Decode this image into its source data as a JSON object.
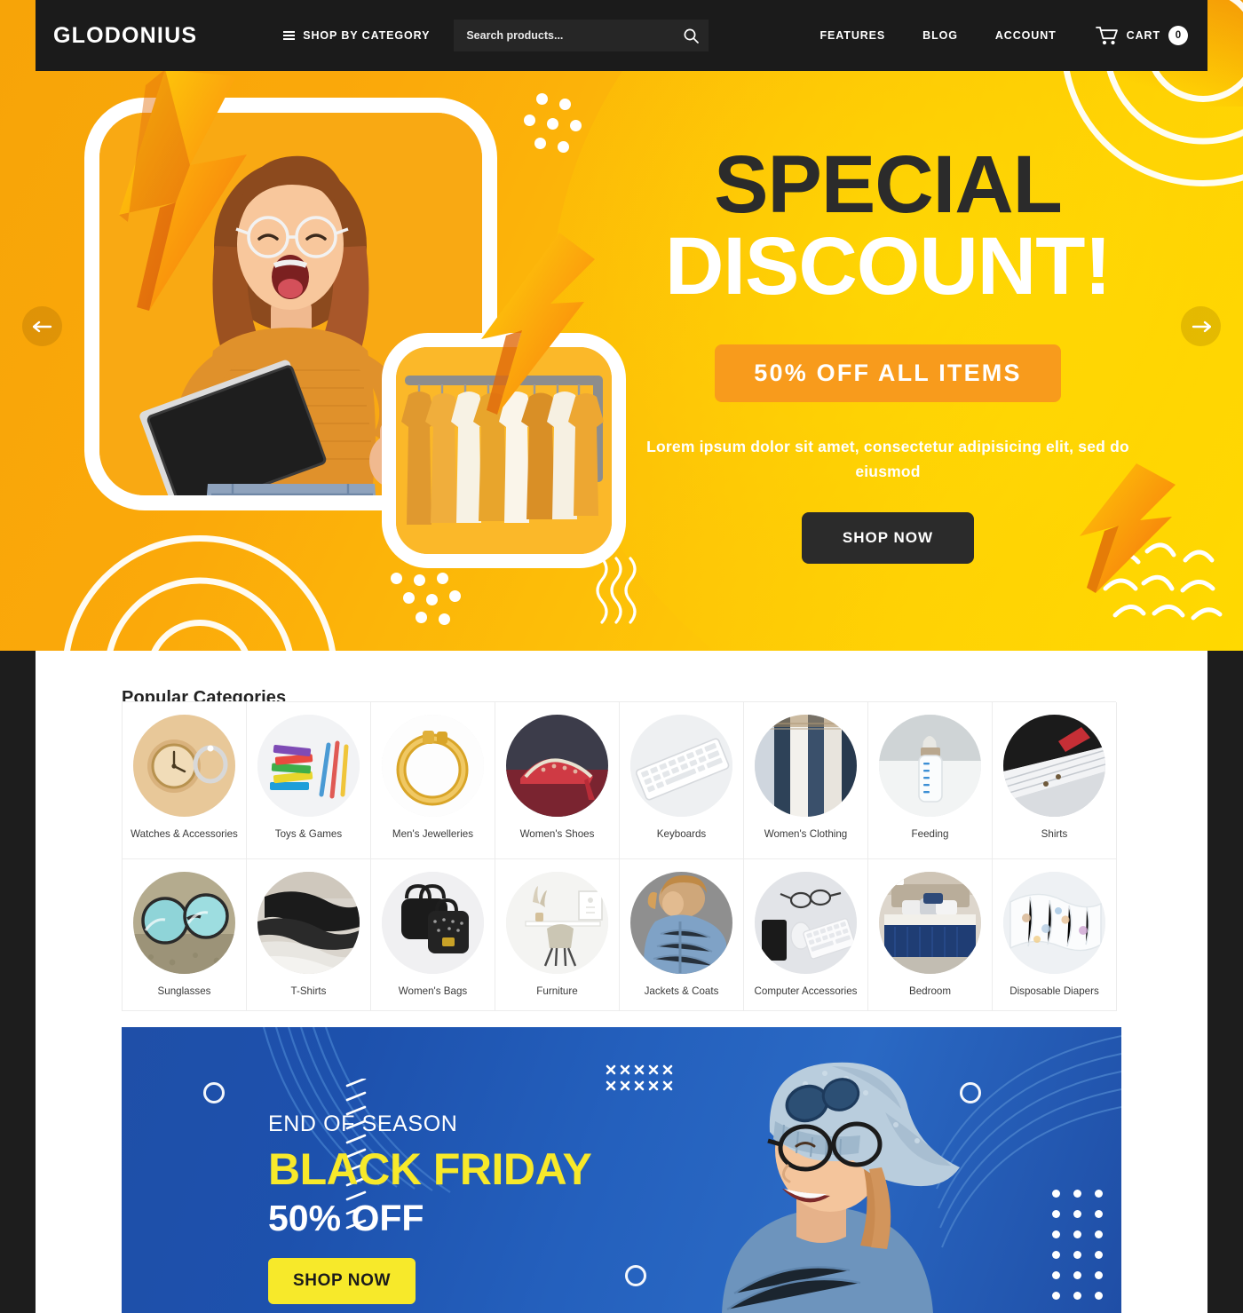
{
  "theme": {
    "header_bg": "#1b1b1b",
    "page_bg": "#1d1d1d",
    "hero_orange": "#f7a408",
    "hero_yellow": "#ffd900",
    "badge_orange": "#f89b1c",
    "dark": "#2b2b2b",
    "banner_blue": "#1f4fa8",
    "banner_yellow": "#f7e92a"
  },
  "header": {
    "logo": "GLODONIUS",
    "shop_by_category": "SHOP BY CATEGORY",
    "menu_icon": "hamburger-icon",
    "search": {
      "placeholder": "Search products...",
      "value": "",
      "icon": "search-icon"
    },
    "nav": [
      {
        "label": "FEATURES"
      },
      {
        "label": "BLOG"
      },
      {
        "label": "ACCOUNT"
      }
    ],
    "cart": {
      "label": "CART",
      "count": "0",
      "icon": "shopping-cart-icon"
    }
  },
  "hero": {
    "title_line1": "SPECIAL",
    "title_line2": "DISCOUNT!",
    "badge": "50% OFF ALL ITEMS",
    "subtitle": "Lorem ipsum dolor sit amet, consectetur adipisicing elit, sed do eiusmod",
    "cta": "SHOP NOW",
    "prev_icon": "arrow-left-icon",
    "next_icon": "arrow-right-icon",
    "image_alt_large": "woman-with-laptop-photo",
    "image_alt_small": "clothing-rack-photo"
  },
  "categories": {
    "title": "Popular Categories",
    "items": [
      {
        "label": "Watches & Accessories",
        "image": "watch-jewelry-thumb"
      },
      {
        "label": "Toys & Games",
        "image": "colorful-blocks-thumb"
      },
      {
        "label": "Men's Jewelleries",
        "image": "gold-bracelet-thumb"
      },
      {
        "label": "Women's Shoes",
        "image": "red-heels-thumb"
      },
      {
        "label": "Keyboards",
        "image": "white-keyboard-thumb"
      },
      {
        "label": "Women's Clothing",
        "image": "hanging-clothes-thumb"
      },
      {
        "label": "Feeding",
        "image": "baby-bottle-thumb"
      },
      {
        "label": "Shirts",
        "image": "dress-shirt-thumb"
      },
      {
        "label": "Sunglasses",
        "image": "round-sunglasses-thumb"
      },
      {
        "label": "T-Shirts",
        "image": "folded-tshirts-thumb"
      },
      {
        "label": "Women's Bags",
        "image": "black-handbags-thumb"
      },
      {
        "label": "Furniture",
        "image": "desk-chair-thumb"
      },
      {
        "label": "Jackets & Coats",
        "image": "denim-jacket-thumb"
      },
      {
        "label": "Computer Accessories",
        "image": "desk-setup-thumb"
      },
      {
        "label": "Bedroom",
        "image": "blue-bed-thumb"
      },
      {
        "label": "Disposable Diapers",
        "image": "diapers-thumb"
      }
    ]
  },
  "promo_banner": {
    "eyebrow": "END OF SEASON",
    "title": "BLACK FRIDAY",
    "discount": "50% OFF",
    "cta": "SHOP NOW",
    "image_alt": "smiling-woman-beanie-photo"
  }
}
